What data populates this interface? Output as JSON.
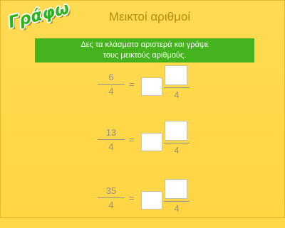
{
  "logo": {
    "text": "Γράφω"
  },
  "title": "Μεικτοί αριθμοί",
  "banner": {
    "line1": "Δες τα κλάσματα αριστερά και γράψε",
    "line2": "τους μεικτούς αριθμούς."
  },
  "problems": [
    {
      "numerator": "6",
      "denominator": "4",
      "equals": "=",
      "whole_value": "",
      "mixed_numerator_value": "",
      "mixed_denominator": "4"
    },
    {
      "numerator": "13",
      "denominator": "4",
      "equals": "=",
      "whole_value": "",
      "mixed_numerator_value": "",
      "mixed_denominator": "4"
    },
    {
      "numerator": "35",
      "denominator": "4",
      "equals": "=",
      "whole_value": "",
      "mixed_numerator_value": "",
      "mixed_denominator": "4"
    }
  ]
}
